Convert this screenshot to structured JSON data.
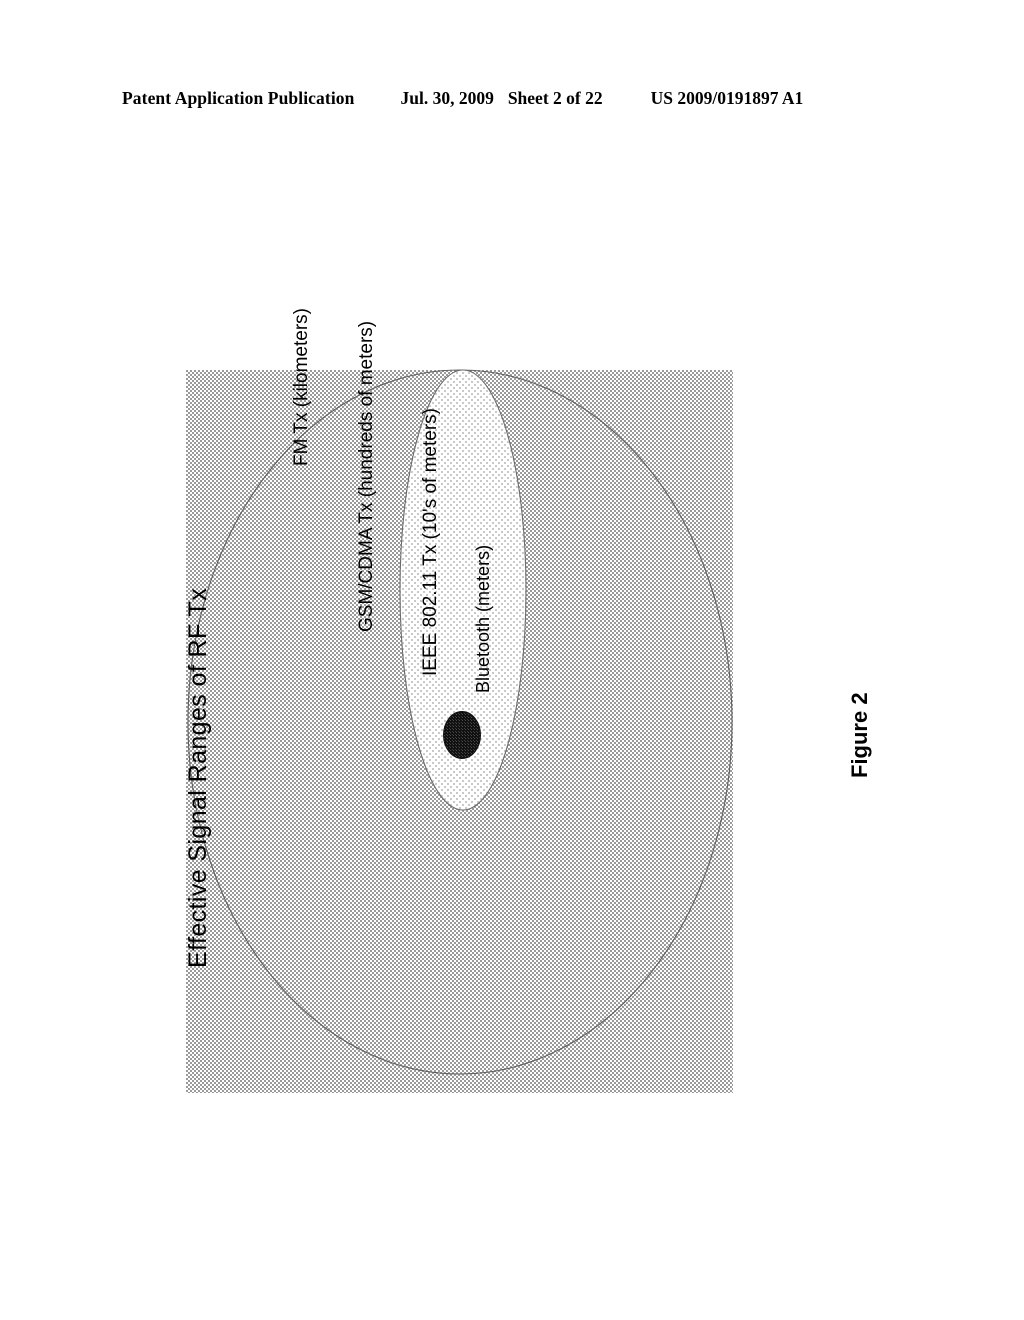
{
  "header": {
    "publication": "Patent Application Publication",
    "date": "Jul. 30, 2009",
    "sheet": "Sheet 2 of 22",
    "document_number": "US 2009/0191897 A1"
  },
  "figure": {
    "caption": "Figure 2",
    "title": "Effective Signal Ranges of RF Tx"
  },
  "regions": [
    {
      "id": "fm",
      "label": "FM Tx (kilometers)",
      "shape": "rectangle",
      "fill_pattern": "dither-50",
      "fill_color": "#808080"
    },
    {
      "id": "gsm",
      "label": "GSM/CDMA Tx (hundreds of meters)",
      "shape": "ellipse",
      "fill_pattern": "dither-50",
      "fill_color": "#808080"
    },
    {
      "id": "ieee80211",
      "label": "IEEE 802.11 Tx (10's of meters)",
      "shape": "ellipse",
      "fill_pattern": "dither-12",
      "fill_color": "#d9d9d9"
    },
    {
      "id": "bluetooth",
      "label": "Bluetooth (meters)",
      "shape": "ellipse",
      "fill_pattern": "dither-solid",
      "fill_color": "#1a1a1a"
    }
  ],
  "colors": {
    "ink": "#000000",
    "outline": "#555555",
    "page_background": "#ffffff"
  }
}
